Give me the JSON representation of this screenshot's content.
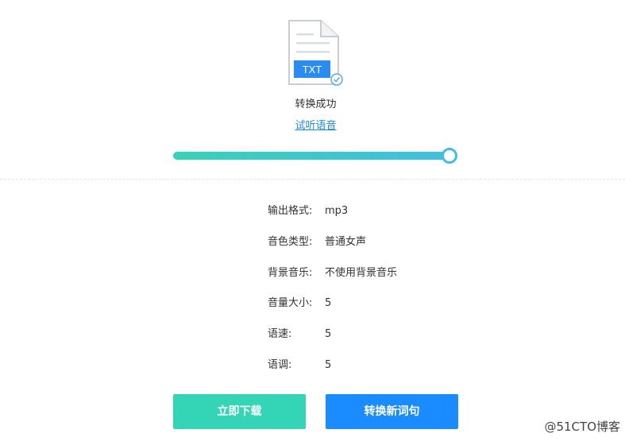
{
  "file": {
    "icon": "txt-file-check-icon",
    "type_label": "TXT"
  },
  "status": "转换成功",
  "listen_link": "试听语音",
  "progress": {
    "fraction": 1.0
  },
  "details": [
    {
      "label": "输出格式:",
      "value": "mp3"
    },
    {
      "label": "音色类型:",
      "value": "普通女声"
    },
    {
      "label": "背景音乐:",
      "value": "不使用背景音乐"
    },
    {
      "label": "音量大小:",
      "value": "5"
    },
    {
      "label": "语速:",
      "value": "5"
    },
    {
      "label": "语调:",
      "value": "5"
    }
  ],
  "buttons": {
    "download": "立即下载",
    "convert_new": "转换新词句"
  },
  "watermark": "@51CTO博客",
  "colors": {
    "accent_green": "#34d5b6",
    "accent_blue": "#1a8cff",
    "link_blue": "#1e88e5"
  }
}
